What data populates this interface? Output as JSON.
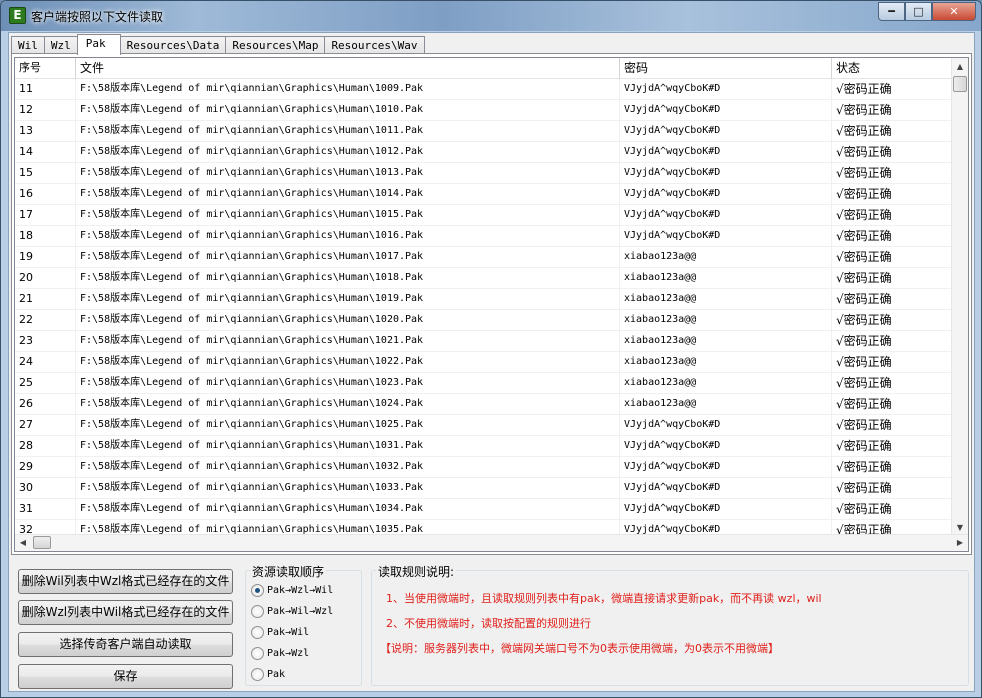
{
  "window": {
    "title": "客户端按照以下文件读取",
    "icon_letter": "E",
    "controls": {
      "minimize": "━",
      "maximize": "□",
      "close": "✕"
    }
  },
  "tabs": [
    {
      "label": "Wil",
      "active": false
    },
    {
      "label": "Wzl",
      "active": false
    },
    {
      "label": "Pak",
      "active": true
    },
    {
      "label": "Resources\\Data",
      "active": false
    },
    {
      "label": "Resources\\Map",
      "active": false
    },
    {
      "label": "Resources\\Wav",
      "active": false
    }
  ],
  "table": {
    "columns": [
      "序号",
      "文件",
      "密码",
      "状态"
    ],
    "rows": [
      [
        "11",
        "F:\\58版本库\\Legend of mir\\qiannian\\Graphics\\Human\\1009.Pak",
        "VJyjdA^wqyCboK#D",
        "√密码正确"
      ],
      [
        "12",
        "F:\\58版本库\\Legend of mir\\qiannian\\Graphics\\Human\\1010.Pak",
        "VJyjdA^wqyCboK#D",
        "√密码正确"
      ],
      [
        "13",
        "F:\\58版本库\\Legend of mir\\qiannian\\Graphics\\Human\\1011.Pak",
        "VJyjdA^wqyCboK#D",
        "√密码正确"
      ],
      [
        "14",
        "F:\\58版本库\\Legend of mir\\qiannian\\Graphics\\Human\\1012.Pak",
        "VJyjdA^wqyCboK#D",
        "√密码正确"
      ],
      [
        "15",
        "F:\\58版本库\\Legend of mir\\qiannian\\Graphics\\Human\\1013.Pak",
        "VJyjdA^wqyCboK#D",
        "√密码正确"
      ],
      [
        "16",
        "F:\\58版本库\\Legend of mir\\qiannian\\Graphics\\Human\\1014.Pak",
        "VJyjdA^wqyCboK#D",
        "√密码正确"
      ],
      [
        "17",
        "F:\\58版本库\\Legend of mir\\qiannian\\Graphics\\Human\\1015.Pak",
        "VJyjdA^wqyCboK#D",
        "√密码正确"
      ],
      [
        "18",
        "F:\\58版本库\\Legend of mir\\qiannian\\Graphics\\Human\\1016.Pak",
        "VJyjdA^wqyCboK#D",
        "√密码正确"
      ],
      [
        "19",
        "F:\\58版本库\\Legend of mir\\qiannian\\Graphics\\Human\\1017.Pak",
        "xiabao123a@@",
        "√密码正确"
      ],
      [
        "20",
        "F:\\58版本库\\Legend of mir\\qiannian\\Graphics\\Human\\1018.Pak",
        "xiabao123a@@",
        "√密码正确"
      ],
      [
        "21",
        "F:\\58版本库\\Legend of mir\\qiannian\\Graphics\\Human\\1019.Pak",
        "xiabao123a@@",
        "√密码正确"
      ],
      [
        "22",
        "F:\\58版本库\\Legend of mir\\qiannian\\Graphics\\Human\\1020.Pak",
        "xiabao123a@@",
        "√密码正确"
      ],
      [
        "23",
        "F:\\58版本库\\Legend of mir\\qiannian\\Graphics\\Human\\1021.Pak",
        "xiabao123a@@",
        "√密码正确"
      ],
      [
        "24",
        "F:\\58版本库\\Legend of mir\\qiannian\\Graphics\\Human\\1022.Pak",
        "xiabao123a@@",
        "√密码正确"
      ],
      [
        "25",
        "F:\\58版本库\\Legend of mir\\qiannian\\Graphics\\Human\\1023.Pak",
        "xiabao123a@@",
        "√密码正确"
      ],
      [
        "26",
        "F:\\58版本库\\Legend of mir\\qiannian\\Graphics\\Human\\1024.Pak",
        "xiabao123a@@",
        "√密码正确"
      ],
      [
        "27",
        "F:\\58版本库\\Legend of mir\\qiannian\\Graphics\\Human\\1025.Pak",
        "VJyjdA^wqyCboK#D",
        "√密码正确"
      ],
      [
        "28",
        "F:\\58版本库\\Legend of mir\\qiannian\\Graphics\\Human\\1031.Pak",
        "VJyjdA^wqyCboK#D",
        "√密码正确"
      ],
      [
        "29",
        "F:\\58版本库\\Legend of mir\\qiannian\\Graphics\\Human\\1032.Pak",
        "VJyjdA^wqyCboK#D",
        "√密码正确"
      ],
      [
        "30",
        "F:\\58版本库\\Legend of mir\\qiannian\\Graphics\\Human\\1033.Pak",
        "VJyjdA^wqyCboK#D",
        "√密码正确"
      ],
      [
        "31",
        "F:\\58版本库\\Legend of mir\\qiannian\\Graphics\\Human\\1034.Pak",
        "VJyjdA^wqyCboK#D",
        "√密码正确"
      ],
      [
        "32",
        "F:\\58版本库\\Legend of mir\\qiannian\\Graphics\\Human\\1035.Pak",
        "VJyjdA^wqyCboK#D",
        "√密码正确"
      ]
    ]
  },
  "buttons": {
    "delete_wil": "删除Wil列表中Wzl格式已经存在的文件",
    "delete_wzl": "删除Wzl列表中Wil格式已经存在的文件",
    "auto_read": "选择传奇客户端自动读取",
    "save": "保存"
  },
  "read_order": {
    "title": "资源读取顺序",
    "options": [
      {
        "label": "Pak→Wzl→Wil",
        "selected": true
      },
      {
        "label": "Pak→Wil→Wzl",
        "selected": false
      },
      {
        "label": "Pak→Wil",
        "selected": false
      },
      {
        "label": "Pak→Wzl",
        "selected": false
      },
      {
        "label": "Pak",
        "selected": false
      }
    ]
  },
  "rules": {
    "title": "读取规则说明:",
    "lines": [
      "1、当使用微端时，且读取规则列表中有pak，微端直接请求更新pak，而不再读 wzl，wil",
      "2、不使用微端时，读取按配置的规则进行",
      "【说明：服务器列表中，微端网关端口号不为0表示使用微端，为0表示不用微端】"
    ],
    "color": "#e0201b"
  }
}
